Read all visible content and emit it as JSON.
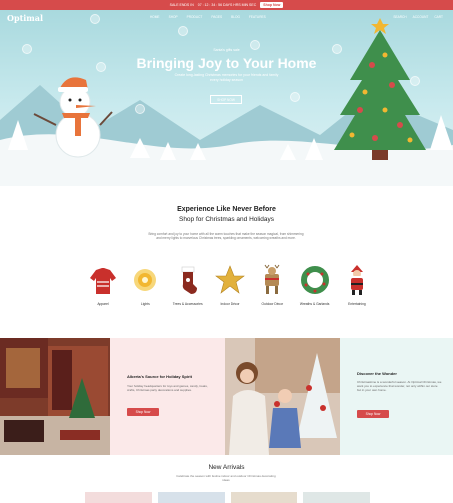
{
  "announcement": {
    "text": "SALE ENDS IN",
    "timer": "07 : 12 : 34 : 56  DAYS  HRS  MIN  SEC",
    "button": "Shop Now"
  },
  "header": {
    "logo": "Optimal",
    "menu": [
      "HOME",
      "SHOP",
      "PRODUCT",
      "PAGES",
      "BLOG",
      "FEATURES"
    ],
    "icons": [
      "SEARCH",
      "ACCOUNT",
      "CART"
    ]
  },
  "hero": {
    "eyebrow": "Santa's gifts sale",
    "title": "Bringing Joy to Your Home",
    "subtitle": "Create long-lasting Christmas memories for your friends and family every holiday season",
    "button": "SHOP NOW"
  },
  "intro": {
    "title": "Experience Like Never Before",
    "subtitle": "Shop for Christmas and Holidays",
    "description": "Bring comfort and joy to your home with all the warm touches that make the season magical, from shimmering and merry lights to marvelous Christmas trees, sparkling ornaments, welcoming wreaths and more."
  },
  "categories": [
    {
      "label": "Apparel",
      "icon": "sweater-icon"
    },
    {
      "label": "Lights",
      "icon": "lights-icon"
    },
    {
      "label": "Trees & Accessories",
      "icon": "stocking-icon"
    },
    {
      "label": "Indoor Décor",
      "icon": "star-icon"
    },
    {
      "label": "Outdoor Décor",
      "icon": "reindeer-icon"
    },
    {
      "label": "Wreaths & Garlands",
      "icon": "wreath-icon"
    },
    {
      "label": "Entertaining",
      "icon": "santa-icon"
    }
  ],
  "promo_left": {
    "title": "Alberta's Source for Holiday Spirit",
    "text": "Your holiday headquarters for toys and games, candy, treats, crafts, Christmas party decorations and supplies.",
    "button": "Shop Now"
  },
  "promo_right": {
    "title": "Discover the Wonder",
    "text": "Christmastime is a wonderful season. At Optimal Christmas, we want you to experience that wonder, not only within our store but in your own home.",
    "button": "Shop Now"
  },
  "new_arrivals": {
    "title": "New Arrivals",
    "subtitle": "Celebrate the season with festive indoor and outdoor Christmas decorating ideas"
  },
  "colors": {
    "accent": "#d64b4b",
    "sky": "#a9d9de",
    "pink_panel": "#fbe9e9",
    "mint_panel": "#eaf6f4"
  }
}
